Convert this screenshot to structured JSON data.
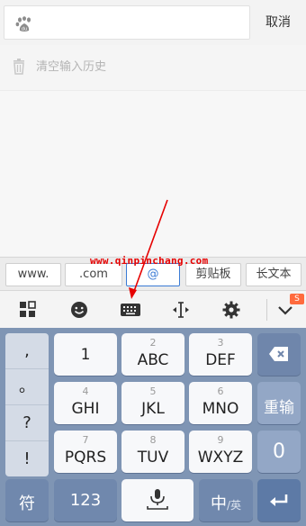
{
  "search": {
    "cancel_label": "取消"
  },
  "history": {
    "clear_label": "清空输入历史"
  },
  "candidates": [
    "www.",
    ".com",
    "@",
    "剪贴板",
    "长文本"
  ],
  "watermark": "www.qinpinchang.com",
  "brand_mark": "S",
  "keyboard": {
    "symbols": [
      ",",
      "。",
      "?",
      "!"
    ],
    "rows": [
      [
        {
          "num": "",
          "label": "1"
        },
        {
          "num": "2",
          "label": "ABC"
        },
        {
          "num": "3",
          "label": "DEF"
        }
      ],
      [
        {
          "num": "4",
          "label": "GHI"
        },
        {
          "num": "5",
          "label": "JKL"
        },
        {
          "num": "6",
          "label": "MNO"
        }
      ],
      [
        {
          "num": "7",
          "label": "PQRS"
        },
        {
          "num": "8",
          "label": "TUV"
        },
        {
          "num": "9",
          "label": "WXYZ"
        }
      ]
    ],
    "reinput_label": "重输",
    "zero_label": "0",
    "symbol_key": "符",
    "num_key": "123",
    "lang_key_main": "中",
    "lang_key_sub": "/英"
  },
  "colors": {
    "keyboard_bg": "#7f95b4",
    "function_key": "#6f86ab",
    "accent_red": "#e60000"
  }
}
